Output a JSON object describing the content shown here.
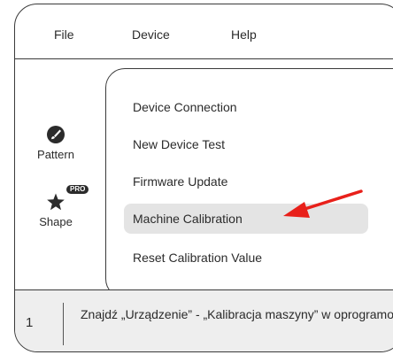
{
  "menubar": {
    "items": [
      {
        "label": "File"
      },
      {
        "label": "Device"
      },
      {
        "label": "Help"
      }
    ]
  },
  "sidebar": {
    "tools": [
      {
        "label": "Pattern",
        "icon": "brush-icon"
      },
      {
        "label": "Shape",
        "icon": "star-icon",
        "badge": "PRO"
      }
    ]
  },
  "device_menu": {
    "items": [
      {
        "label": "Device Connection"
      },
      {
        "label": "New Device Test"
      },
      {
        "label": "Firmware Update"
      },
      {
        "label": "Machine Calibration",
        "highlighted": true
      },
      {
        "label": "Reset Calibration Value"
      }
    ]
  },
  "caption": {
    "step": "1",
    "text": "Znajdź „Urządzenie” - „Kalibracja maszyny” w oprogramowaniu;"
  },
  "colors": {
    "highlight": "#e4e4e4",
    "arrow": "#e8201a",
    "caption_bg": "#eeeeee",
    "border": "#3a3a3a"
  }
}
